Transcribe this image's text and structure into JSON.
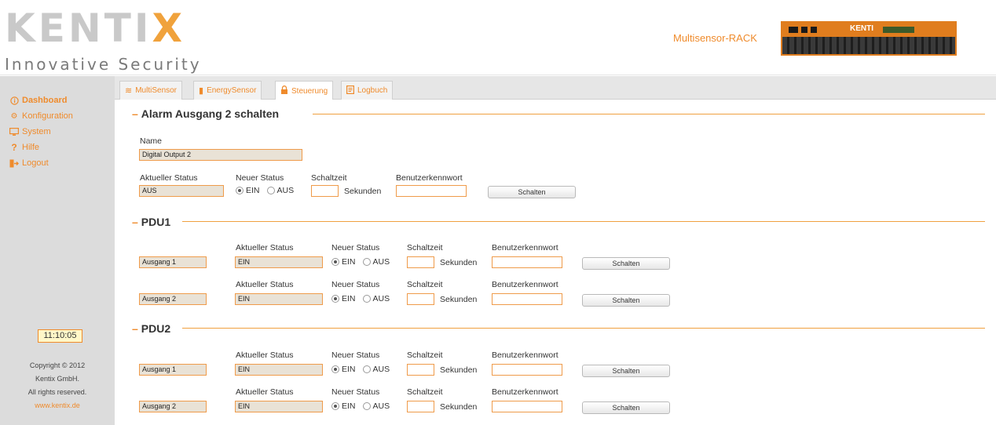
{
  "header": {
    "logo_text": "KENTI",
    "logo_x": "X",
    "tagline": "Innovative Security",
    "device_name": "Multisensor-RACK",
    "rack_brand": "KENTI"
  },
  "sidebar": {
    "items": [
      {
        "label": "Dashboard",
        "icon": "info-circle-icon"
      },
      {
        "label": "Konfiguration",
        "icon": "gears-icon"
      },
      {
        "label": "System",
        "icon": "monitor-icon"
      },
      {
        "label": "Hilfe",
        "icon": "question-icon"
      },
      {
        "label": "Logout",
        "icon": "logout-icon"
      }
    ],
    "clock": "11:10:05",
    "copyright": "Copyright © 2012",
    "company": "Kentix GmbH.",
    "rights": "All rights reserved.",
    "website": "www.kentix.de"
  },
  "tabs": [
    {
      "label": "MultiSensor",
      "icon": "multisensor-icon"
    },
    {
      "label": "EnergySensor",
      "icon": "energy-icon"
    },
    {
      "label": "Steuerung",
      "icon": "lock-icon"
    },
    {
      "label": "Logbuch",
      "icon": "logbook-icon"
    }
  ],
  "alarm": {
    "title": "Alarm Ausgang 2 schalten",
    "name_label": "Name",
    "name_value": "Digital Output 2",
    "status_label": "Aktueller Status",
    "status_value": "AUS",
    "new_status_label": "Neuer Status",
    "ein": "EIN",
    "aus": "AUS",
    "time_label": "Schaltzeit",
    "seconds": "Sekunden",
    "password_label": "Benutzerkennwort",
    "button": "Schalten"
  },
  "pdu1": {
    "title": "PDU1",
    "rows": [
      {
        "output": "Ausgang 1",
        "status": "EIN"
      },
      {
        "output": "Ausgang 2",
        "status": "EIN"
      }
    ]
  },
  "pdu2": {
    "title": "PDU2",
    "rows": [
      {
        "output": "Ausgang 1",
        "status": "EIN"
      },
      {
        "output": "Ausgang 2",
        "status": "EIN"
      }
    ]
  },
  "labels": {
    "status": "Aktueller Status",
    "new_status": "Neuer Status",
    "time": "Schaltzeit",
    "password": "Benutzerkennwort",
    "ein": "EIN",
    "aus": "AUS",
    "seconds": "Sekunden",
    "button": "Schalten"
  },
  "colors": {
    "accent": "#ef8b2c",
    "sidebar_bg": "#dcdcdc",
    "readonly_field_bg": "#e9e2d6"
  }
}
